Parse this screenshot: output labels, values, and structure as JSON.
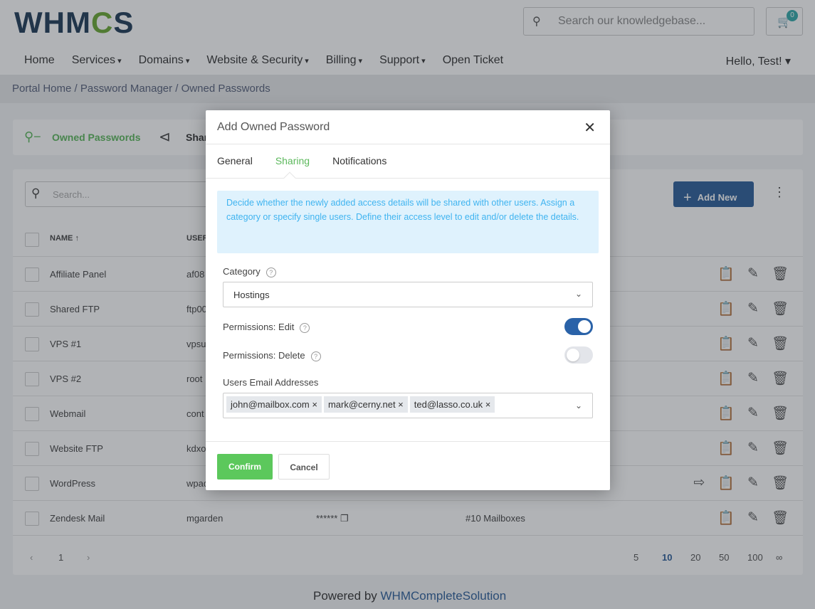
{
  "header": {
    "logo": "WHMCS",
    "search_placeholder": "Search our knowledgebase...",
    "cart_count": "0",
    "nav": [
      "Home",
      "Services",
      "Domains",
      "Website & Security",
      "Billing",
      "Support",
      "Open Ticket"
    ],
    "greeting": "Hello, Test!"
  },
  "breadcrumb": [
    "Portal Home",
    "Password Manager",
    "Owned Passwords"
  ],
  "tabs": {
    "owned": "Owned Passwords",
    "shared": "Shar"
  },
  "table": {
    "search_placeholder": "Search...",
    "add_new": "Add New",
    "col_name": "NAME ↑",
    "col_user": "USER",
    "rows": [
      {
        "name": "Affiliate Panel",
        "user": "af08"
      },
      {
        "name": "Shared FTP",
        "user": "ftp00"
      },
      {
        "name": "VPS #1",
        "user": "vpsu"
      },
      {
        "name": "VPS #2",
        "user": "root"
      },
      {
        "name": "Webmail",
        "user": "cont"
      },
      {
        "name": "Website FTP",
        "user": "kdxo"
      },
      {
        "name": "WordPress",
        "user": "wpad"
      },
      {
        "name": "Zendesk Mail",
        "user": "mgarden",
        "password": "******",
        "description": "#10 Mailboxes"
      }
    ],
    "page": "1",
    "page_sizes": [
      "5",
      "10",
      "20",
      "50",
      "100",
      "∞"
    ],
    "active_page_size": "10"
  },
  "footer": {
    "prefix": "Powered by ",
    "link": "WHMCompleteSolution"
  },
  "modal": {
    "title": "Add Owned Password",
    "tabs": [
      "General",
      "Sharing",
      "Notifications"
    ],
    "active_tab": "Sharing",
    "info": "Decide whether the newly added access details will be shared with other users. Assign a category or specify single users. Define their access level to edit and/or delete the details.",
    "category_label": "Category",
    "category_value": "Hostings",
    "perm_edit_label": "Permissions: Edit",
    "perm_edit": true,
    "perm_delete_label": "Permissions: Delete",
    "perm_delete": false,
    "emails_label": "Users Email Addresses",
    "emails": [
      "john@mailbox.com",
      "mark@cerny.net",
      "ted@lasso.co.uk"
    ],
    "confirm": "Confirm",
    "cancel": "Cancel"
  },
  "colors": {
    "accent_green": "#5cb85c",
    "primary_blue": "#2d5e9a",
    "info_bg": "#dff2fd",
    "info_text": "#40b4f0"
  }
}
